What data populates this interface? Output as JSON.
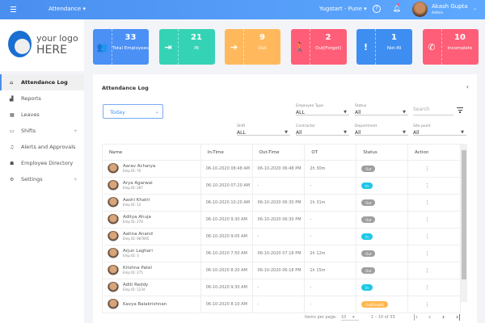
{
  "topbar": {
    "module": "Attendance ▾",
    "location": "Yugstart - Pune ▾",
    "user_name": "Akash Gupta",
    "user_role": "Admin"
  },
  "logo": {
    "line1": "your logo",
    "line2": "HERE"
  },
  "sidebar": {
    "items": [
      {
        "label": "Attendance Log",
        "icon": "home-icon",
        "active": true
      },
      {
        "label": "Reports",
        "icon": "bar-chart-icon"
      },
      {
        "label": "Leaves",
        "icon": "calendar-icon"
      },
      {
        "label": "Shifts",
        "icon": "shift-icon",
        "expandable": true
      },
      {
        "label": "Alerts and Approvals",
        "icon": "bell-icon"
      },
      {
        "label": "Employee Directory",
        "icon": "person-icon"
      },
      {
        "label": "Settings",
        "icon": "gear-icon",
        "expandable": true
      }
    ]
  },
  "cards": [
    {
      "value": "33",
      "label": "Total Employees",
      "color": "#4a90f5",
      "icon": "group-icon",
      "glyph": "👥"
    },
    {
      "value": "21",
      "label": "IN",
      "color": "#35d3b5",
      "icon": "sign-in-icon",
      "glyph": "⇥"
    },
    {
      "value": "9",
      "label": "Out",
      "color": "#ffb95c",
      "icon": "sign-out-icon",
      "glyph": "➔"
    },
    {
      "value": "2",
      "label": "Out[Forgot]",
      "color": "#ff5e78",
      "icon": "walking-icon",
      "glyph": "🚶"
    },
    {
      "value": "1",
      "label": "Not-IN",
      "color": "#3d8ef0",
      "icon": "exclamation-icon",
      "glyph": "!"
    },
    {
      "value": "10",
      "label": "Incomplete",
      "color": "#ff5e78",
      "icon": "phone-icon",
      "glyph": "✆"
    }
  ],
  "panel": {
    "title": "Attendance Log",
    "date_range": "Today",
    "search_placeholder": "Search",
    "filters": {
      "employee_type": {
        "label": "Employee Type",
        "value": "ALL"
      },
      "status": {
        "label": "Status",
        "value": "All"
      },
      "shift": {
        "label": "Shift",
        "value": "ALL"
      },
      "contractor": {
        "label": "Contractor",
        "value": "All"
      },
      "department": {
        "label": "Department",
        "value": "All"
      },
      "site_point": {
        "label": "Site point",
        "value": "All"
      }
    }
  },
  "table": {
    "columns": [
      "Name",
      "In-Time",
      "Out-Time",
      "OT",
      "Status",
      "Action"
    ],
    "rows": [
      {
        "name": "Aarav Acharya",
        "emp": "Emp ID: 70",
        "in": "06-10-2020 08:48 AM",
        "out": "06-10-2020 06:48 PM",
        "ot": "2h 30m",
        "status": "Out"
      },
      {
        "name": "Arya Agarwal",
        "emp": "Emp ID: 287",
        "in": "06-10-2020 07:20 AM",
        "out": "-",
        "ot": "-",
        "status": "In"
      },
      {
        "name": "Aashi Khatri",
        "emp": "Emp ID: 12",
        "in": "06-10-2020 10:20 AM",
        "out": "06-10-2020 06:30 PM",
        "ot": "1h 31m",
        "status": "Out"
      },
      {
        "name": "Aditya  Ahuja",
        "emp": "Emp ID: 278",
        "in": "06-10-2020 9:30 AM",
        "out": "06-10-2020 06:30 PM",
        "ot": "-",
        "status": "Out"
      },
      {
        "name": "Aahna Anand",
        "emp": "Emp ID: 987695",
        "in": "06-10-2020 9:05 AM",
        "out": "-",
        "ot": "-",
        "status": "In"
      },
      {
        "name": "Arjun Laghari",
        "emp": "Emp ID: 3",
        "in": "06-10-2020 7:50 AM",
        "out": "06-10-2020 07:18 PM",
        "ot": "2h 12m",
        "status": "Out"
      },
      {
        "name": "Krishna Patel",
        "emp": "Emp ID: 275",
        "in": "06-10-2020 8:20 AM",
        "out": "06-10-2020 06:18 PM",
        "ot": "1h 15m",
        "status": "Out"
      },
      {
        "name": "Aditi Reddy",
        "emp": "Emp ID: 1234",
        "in": "06-10-2020 9:30 AM",
        "out": "-",
        "ot": "-",
        "status": "In"
      },
      {
        "name": "Kavya Balakrishnan",
        "emp": "",
        "in": "06-10-2020 8:10 AM",
        "out": "-",
        "ot": "-",
        "status": "Out[Forgot]"
      }
    ]
  },
  "status_colors": {
    "Out": "#9e9e9e",
    "In": "#1ec8e6",
    "Out[Forgot]": "#ffb74d"
  },
  "pagination": {
    "label": "Items per page:",
    "per_page": "10",
    "range": "1 – 10 of 33",
    "first": "|‹",
    "prev": "‹",
    "next": "›",
    "last": "›|"
  }
}
